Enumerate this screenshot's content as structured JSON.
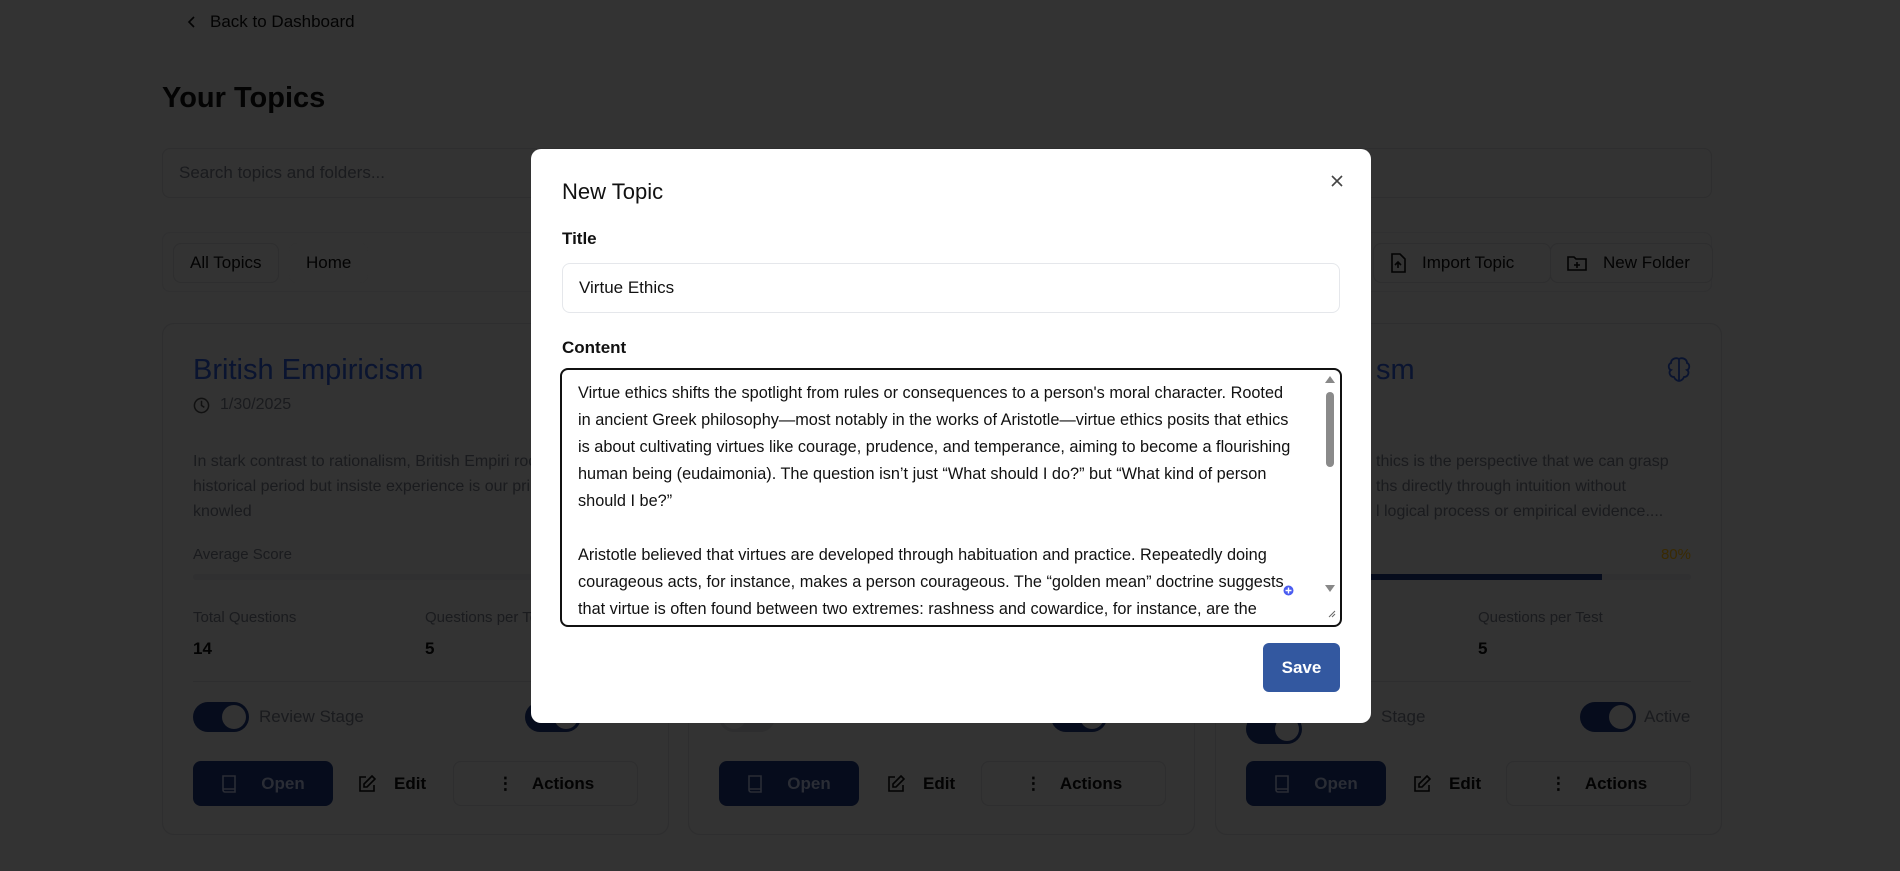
{
  "nav": {
    "back_label": "Back to Dashboard"
  },
  "page": {
    "title": "Your Topics"
  },
  "search": {
    "placeholder": "Search topics and folders..."
  },
  "toolbar": {
    "all_topics": "All Topics",
    "home": "Home",
    "import_topic": "Import Topic",
    "new_folder": "New Folder"
  },
  "cards": [
    {
      "title": "British Empiricism",
      "date": "1/30/2025",
      "description": "In stark contrast to rationalism, British Empiri root in the same historical period but insiste experience is our primary source of knowled",
      "avg_score_label": "Average Score",
      "total_questions_label": "Total Questions",
      "total_questions": "14",
      "qpt_label": "Questions per Te",
      "qpt": "5",
      "review_label": "Review Stage",
      "open": "Open",
      "edit": "Edit",
      "actions": "Actions"
    },
    {
      "open": "Open",
      "edit": "Edit",
      "actions": "Actions"
    },
    {
      "title_fragment": "sm",
      "desc_lines": [
        "thics is the perspective that we can grasp",
        "ths directly through intuition without",
        "l logical process or empirical evidence...."
      ],
      "avg_score": "80%",
      "avg_score_value": 80,
      "qpt_label": "Questions per Test",
      "qpt": "5",
      "review_label_fragment": "Stage",
      "active_label": "Active",
      "open": "Open",
      "edit": "Edit",
      "actions": "Actions"
    }
  ],
  "modal": {
    "title": "New Topic",
    "title_label": "Title",
    "title_value": "Virtue Ethics",
    "content_label": "Content",
    "content_value": "Virtue ethics shifts the spotlight from rules or consequences to a person's moral character. Rooted in ancient Greek philosophy—most notably in the works of Aristotle—virtue ethics posits that ethics is about cultivating virtues like courage, prudence, and temperance, aiming to become a flourishing human being (eudaimonia). The question isn’t just “What should I do?” but “What kind of person should I be?”\n\nAristotle believed that virtues are developed through habituation and practice. Repeatedly doing courageous acts, for instance, makes a person courageous. The “golden mean” doctrine suggests that virtue is often found between two extremes: rashness and cowardice, for instance, are the excess and deficiency around the virtue of courage. So, living ethically is a",
    "save": "Save"
  },
  "colors": {
    "brand": "#1e3a8a",
    "save": "#3358a0",
    "score": "#ca8a04"
  }
}
